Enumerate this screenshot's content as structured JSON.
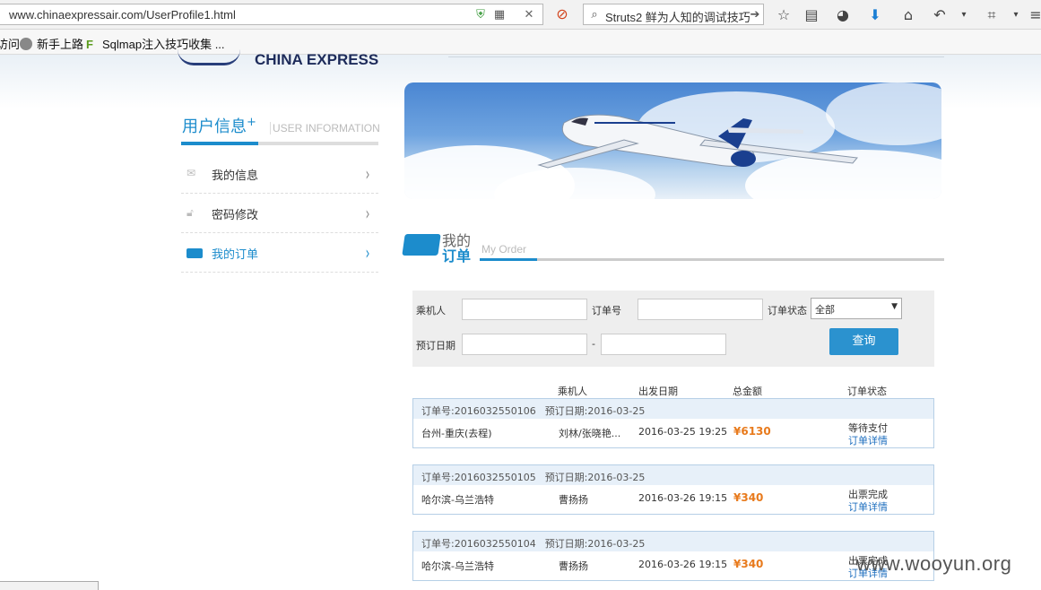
{
  "browser": {
    "url": "www.chinaexpressair.com/UserProfile1.html",
    "search_text": "Struts2 鲜为人知的调试技巧",
    "bookmarks": [
      "访问",
      "新手上路",
      "Sqlmap注入技巧收集 ..."
    ]
  },
  "site": {
    "logo_text": "CHINA EXPRESS"
  },
  "sidebar": {
    "title": "用户信息",
    "title_mark": "+",
    "subtitle": "USER INFORMATION",
    "items": [
      {
        "label": "我的信息",
        "icon": "envelope-icon",
        "active": false
      },
      {
        "label": "密码修改",
        "icon": "lock-icon",
        "active": false
      },
      {
        "label": "我的订单",
        "icon": "folder-icon",
        "active": true
      }
    ]
  },
  "orders_section": {
    "title_line1": "我的",
    "title_line2": "订单",
    "title_en": "My Order"
  },
  "filter": {
    "passenger_label": "乘机人",
    "order_no_label": "订单号",
    "status_label": "订单状态",
    "status_value": "全部",
    "date_label": "预订日期",
    "date_sep": "-",
    "query_label": "查询"
  },
  "columns": [
    "乘机人",
    "出发日期",
    "总金额",
    "订单状态"
  ],
  "orders": [
    {
      "order_no": "订单号:2016032550106",
      "booked": "预订日期:2016-03-25",
      "route": "台州-重庆(去程)",
      "passenger": "刘林/张晓艳...",
      "depart": "2016-03-25 19:25",
      "amount": "¥6130",
      "status": "等待支付",
      "detail": "订单详情"
    },
    {
      "order_no": "订单号:2016032550105",
      "booked": "预订日期:2016-03-25",
      "route": "哈尔滨-乌兰浩特",
      "passenger": "曹扬扬",
      "depart": "2016-03-26 19:15",
      "amount": "¥340",
      "status": "出票完成",
      "detail": "订单详情"
    },
    {
      "order_no": "订单号:2016032550104",
      "booked": "预订日期:2016-03-25",
      "route": "哈尔滨-乌兰浩特",
      "passenger": "曹扬扬",
      "depart": "2016-03-26 19:15",
      "amount": "¥340",
      "status": "出票完成",
      "detail": "订单详情"
    }
  ],
  "watermark": "www.wooyun.org",
  "colors": {
    "accent": "#1c8ccc",
    "amount": "#e87a1c"
  }
}
